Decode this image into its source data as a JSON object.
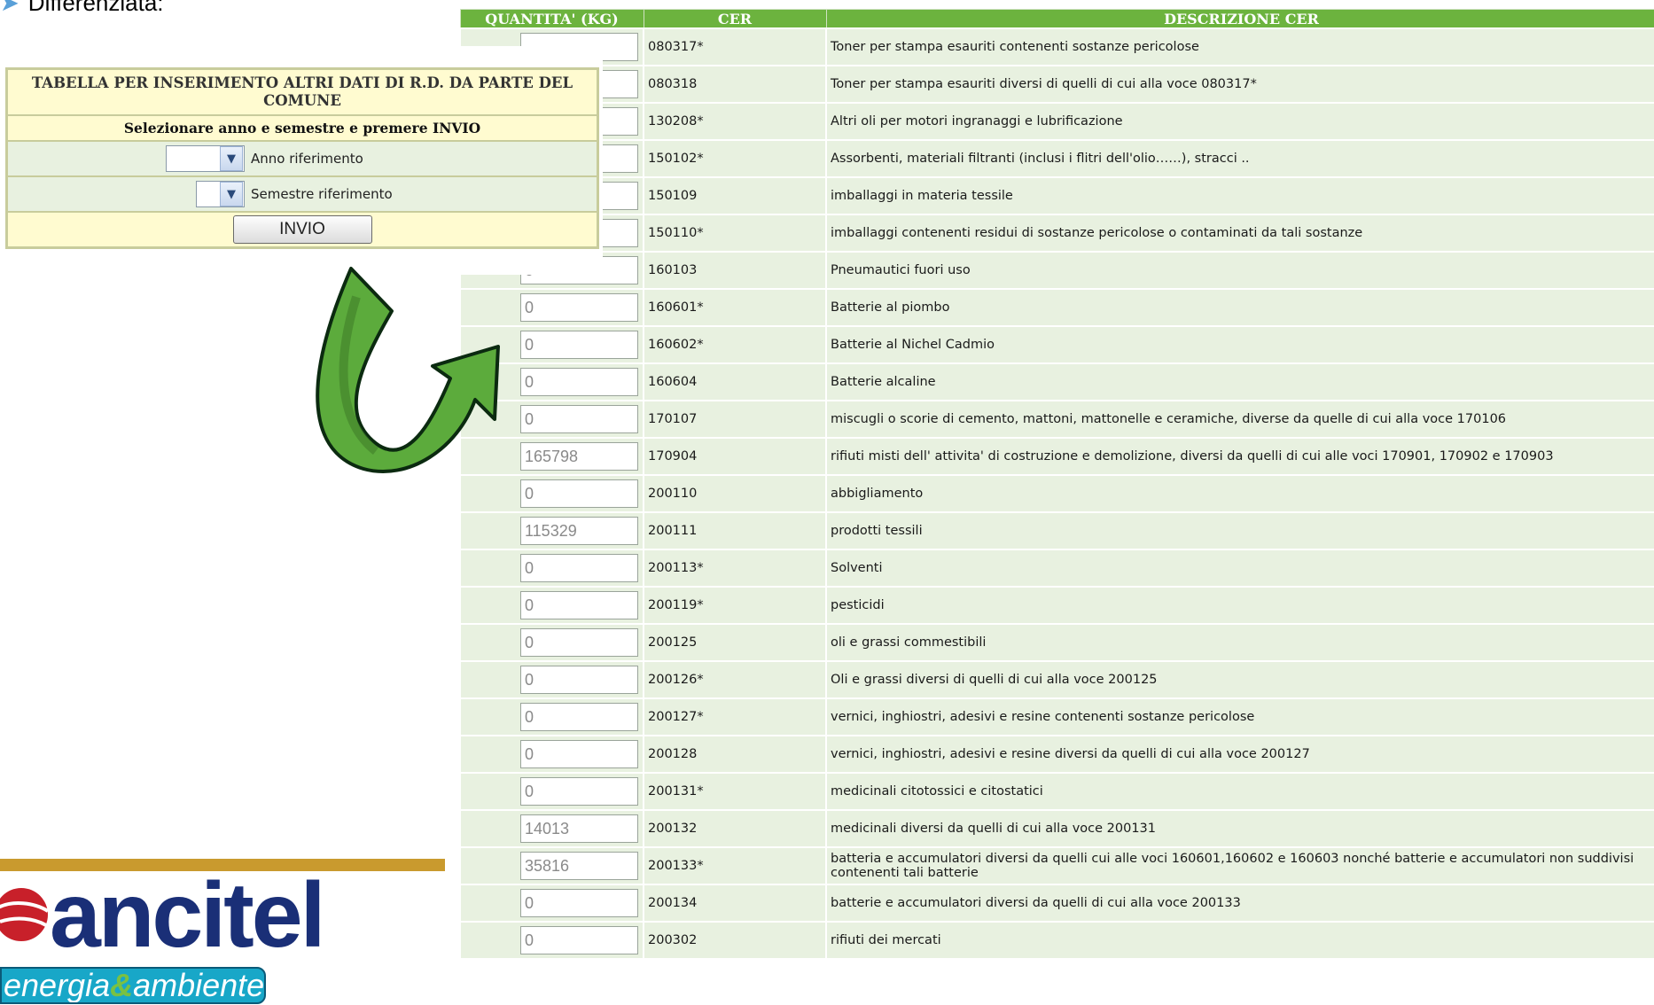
{
  "heading": "Differenziata:",
  "table": {
    "headers": {
      "qty": "QUANTITA' (KG)",
      "cer": "CER",
      "desc": "DESCRIZIONE CER"
    },
    "rows": [
      {
        "qty": "",
        "cer": "080317*",
        "desc": "Toner per stampa esauriti contenenti sostanze pericolose"
      },
      {
        "qty": "",
        "cer": "080318",
        "desc": "Toner per stampa esauriti diversi di quelli di cui alla voce 080317*"
      },
      {
        "qty": "",
        "cer": "130208*",
        "desc": "Altri oli per motori ingranaggi e lubrificazione"
      },
      {
        "qty": "",
        "cer": "150102*",
        "desc": "Assorbenti, materiali filtranti (inclusi i flitri dell'olio……), stracci .."
      },
      {
        "qty": "",
        "cer": "150109",
        "desc": "imballaggi in materia tessile"
      },
      {
        "qty": "",
        "cer": "150110*",
        "desc": "imballaggi contenenti residui di sostanze pericolose o contaminati da tali sostanze"
      },
      {
        "qty": "0",
        "cer": "160103",
        "desc": "Pneumautici fuori uso"
      },
      {
        "qty": "0",
        "cer": "160601*",
        "desc": "Batterie al piombo"
      },
      {
        "qty": "0",
        "cer": "160602*",
        "desc": "Batterie al Nichel Cadmio"
      },
      {
        "qty": "0",
        "cer": "160604",
        "desc": "Batterie alcaline"
      },
      {
        "qty": "0",
        "cer": "170107",
        "desc": "miscugli o scorie di cemento, mattoni, mattonelle e ceramiche, diverse da quelle di cui alla voce 170106"
      },
      {
        "qty": "165798",
        "cer": "170904",
        "desc": "rifiuti misti dell' attivita' di costruzione e demolizione, diversi da quelli di cui alle voci 170901, 170902 e 170903"
      },
      {
        "qty": "0",
        "cer": "200110",
        "desc": "abbigliamento"
      },
      {
        "qty": "115329",
        "cer": "200111",
        "desc": "prodotti tessili"
      },
      {
        "qty": "0",
        "cer": "200113*",
        "desc": "Solventi"
      },
      {
        "qty": "0",
        "cer": "200119*",
        "desc": "pesticidi"
      },
      {
        "qty": "0",
        "cer": "200125",
        "desc": "oli e grassi commestibili"
      },
      {
        "qty": "0",
        "cer": "200126*",
        "desc": "Oli e grassi diversi di quelli di cui alla voce 200125"
      },
      {
        "qty": "0",
        "cer": "200127*",
        "desc": "vernici, inghiostri, adesivi e resine contenenti sostanze pericolose"
      },
      {
        "qty": "0",
        "cer": "200128",
        "desc": "vernici, inghiostri, adesivi e resine diversi da quelli di cui alla voce 200127"
      },
      {
        "qty": "0",
        "cer": "200131*",
        "desc": "medicinali citotossici e citostatici"
      },
      {
        "qty": "14013",
        "cer": "200132",
        "desc": "medicinali diversi da quelli di cui alla voce 200131"
      },
      {
        "qty": "35816",
        "cer": "200133*",
        "desc": "batteria e accumulatori diversi da quelli cui alle voci 160601,160602 e 160603 nonché batterie e accumulatori non suddivisi contenenti tali batterie"
      },
      {
        "qty": "0",
        "cer": "200134",
        "desc": "batterie e accumulatori diversi da quelli di cui alla voce 200133"
      },
      {
        "qty": "0",
        "cer": "200302",
        "desc": "rifiuti dei mercati"
      }
    ]
  },
  "form": {
    "title": "TABELLA PER INSERIMENTO ALTRI DATI DI R.D. DA PARTE DEL COMUNE",
    "instruction": "Selezionare anno e semestre e premere INVIO",
    "year_label": "Anno riferimento",
    "year_value": "",
    "semester_label": "Semestre riferimento",
    "semester_value": "",
    "submit_label": "INVIO"
  },
  "logo": {
    "name": "ancitel",
    "tagline_1": "energia",
    "tagline_amp": "&",
    "tagline_2": "ambiente"
  },
  "colors": {
    "header_green": "#6cb33e",
    "row_bg": "#e8f1e0",
    "form_yellow": "#fffbd0",
    "arrow_green": "#4a9a2a",
    "logo_blue": "#1a2f77",
    "logo_bar": "#c99a2e"
  }
}
